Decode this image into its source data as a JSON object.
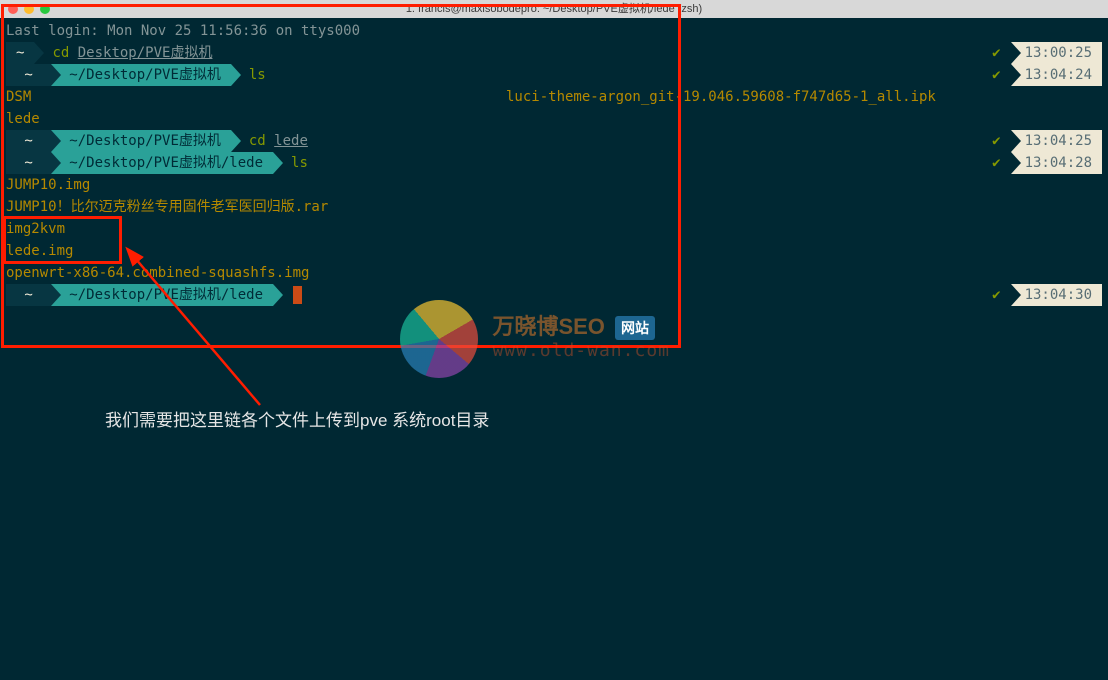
{
  "window": {
    "title": "1. francis@maxisobodepro: ~/Desktop/PVE虚拟机/lede (zsh)",
    "traffic": {
      "close": "#ff5f57",
      "min": "#febc2e",
      "max": "#28c840"
    }
  },
  "lines": {
    "last_login": "Last login: Mon Nov 25 11:56:36 on ttys000",
    "p1": {
      "path": "~",
      "cmd_green": "cd",
      "cmd_arg": "Desktop/PVE虚拟机",
      "time": "13:00:25"
    },
    "p2": {
      "path": "~/Desktop/PVE虚拟机",
      "cmd_green": "ls",
      "cmd_arg": "",
      "time": "13:04:24"
    },
    "ls1_col1": "DSM",
    "ls1_col2": "luci-theme-argon_git-19.046.59608-f747d65-1_all.ipk",
    "ls1_row2": "lede",
    "p3": {
      "path": "~/Desktop/PVE虚拟机",
      "cmd_green": "cd",
      "cmd_arg": "lede",
      "time": "13:04:25"
    },
    "p4": {
      "path": "~/Desktop/PVE虚拟机/lede",
      "cmd_green": "ls",
      "cmd_arg": "",
      "time": "13:04:28"
    },
    "f1": "JUMP10.img",
    "f2": "JUMP10！比尔迈克粉丝专用固件老军医回归版.rar",
    "f3": "img2kvm",
    "f4": "lede.img",
    "f5": "openwrt-x86-64.combined-squashfs.img",
    "p5": {
      "path": "~/Desktop/PVE虚拟机/lede",
      "time": "13:04:30"
    },
    "check": "✔"
  },
  "annotation": {
    "caption": "我们需要把这里链各个文件上传到pve 系统root目录"
  },
  "watermark": {
    "title": "万晓博SEO",
    "badge": "网站",
    "url": "www.old-wan.com"
  }
}
